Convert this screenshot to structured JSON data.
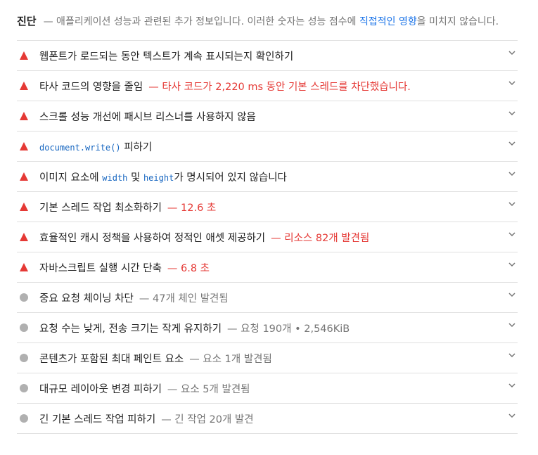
{
  "header": {
    "title": "진단",
    "desc_before": "— 애플리케이션 성능과 관련된 추가 정보입니다. 이러한 숫자는 성능 점수에 ",
    "link": "직접적인 영향",
    "desc_after": "을 미치지 않습니다."
  },
  "colors": {
    "fail": "#e53935",
    "info": "#b0b0b0",
    "link": "#1a73e8"
  },
  "items": [
    {
      "type": "fail",
      "label": "웹폰트가 로드되는 동안 텍스트가 계속 표시되는지 확인하기",
      "detail": ""
    },
    {
      "type": "fail",
      "label": "타사 코드의 영향을 줄임",
      "detail": "— 타사 코드가 2,220 ms 동안 기본 스레드를 차단했습니다."
    },
    {
      "type": "fail",
      "label": "스크롤 성능 개선에 패시브 리스너를 사용하지 않음",
      "detail": ""
    },
    {
      "type": "fail",
      "code1": "document.write()",
      "label_after": " 피하기"
    },
    {
      "type": "fail",
      "label_before": "이미지 요소에 ",
      "code1": "width",
      "label_mid": " 및 ",
      "code2": "height",
      "label_after": "가 명시되어 있지 않습니다"
    },
    {
      "type": "fail",
      "label": "기본 스레드 작업 최소화하기",
      "detail": "— 12.6 초"
    },
    {
      "type": "fail",
      "label": "효율적인 캐시 정책을 사용하여 정적인 애셋 제공하기",
      "detail": "— 리소스 82개 발견됨"
    },
    {
      "type": "fail",
      "label": "자바스크립트 실행 시간 단축",
      "detail": "— 6.8 초"
    },
    {
      "type": "info",
      "label": "중요 요청 체이닝 차단",
      "detail": "— 47개 체인 발견됨"
    },
    {
      "type": "info",
      "label": "요청 수는 낮게, 전송 크기는 작게 유지하기",
      "detail": "— 요청 190개 • 2,546KiB"
    },
    {
      "type": "info",
      "label": "콘텐츠가 포함된 최대 페인트 요소",
      "detail": "— 요소 1개 발견됨"
    },
    {
      "type": "info",
      "label": "대규모 레이아웃 변경 피하기",
      "detail": "— 요소 5개 발견됨"
    },
    {
      "type": "info",
      "label": "긴 기본 스레드 작업 피하기",
      "detail": "— 긴 작업 20개 발견"
    }
  ]
}
